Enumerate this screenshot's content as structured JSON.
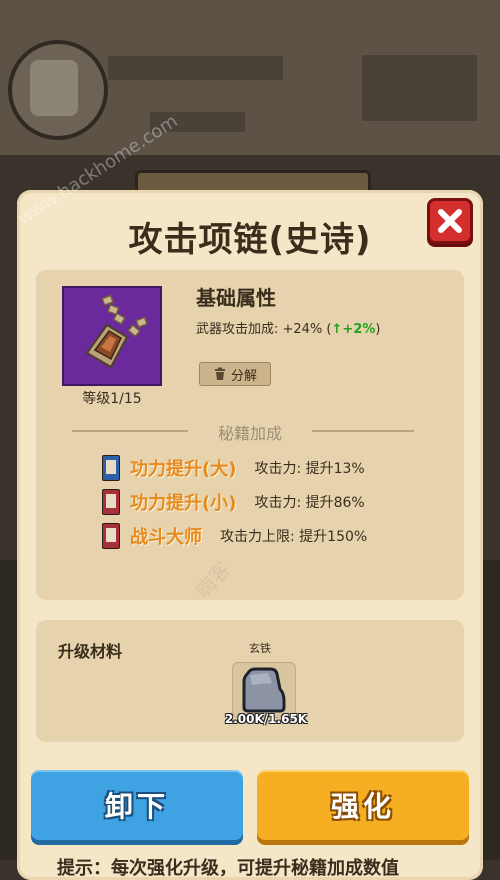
{
  "dialog": {
    "title": "攻击项链(史诗)",
    "close_icon": "close-icon"
  },
  "item": {
    "icon": "necklace-icon",
    "level_text": "等级1/15"
  },
  "basic": {
    "title": "基础属性",
    "stat_text": "武器攻击加成: +24% (",
    "stat_bonus": "+2%",
    "stat_close": ")",
    "decompose_label": "分解"
  },
  "secret": {
    "header": "秘籍加成",
    "books": [
      {
        "name": "功力提升(大)",
        "effect": "攻击力: 提升13%",
        "color": "blue"
      },
      {
        "name": "功力提升(小)",
        "effect": "攻击力: 提升86%",
        "color": "red"
      },
      {
        "name": "战斗大师",
        "effect": "攻击力上限: 提升150%",
        "color": "red"
      }
    ]
  },
  "materials": {
    "title": "升级材料",
    "item_name": "玄铁",
    "count": "2.00K/1.65K"
  },
  "actions": {
    "unequip": "卸下",
    "enhance": "强化"
  },
  "tip": "提示：每次强化升级，可提升秘籍加成数值",
  "watermarks": {
    "primary": "www.hackhome.com",
    "secondary": "嗨客"
  },
  "colors": {
    "bonus_green": "#1fa21f",
    "book_name_orange": "#e58a1b",
    "unequip_blue": "#3fa3e3",
    "enhance_orange": "#f6ae22",
    "close_red": "#d42e2e",
    "item_bg_purple": "#6a2a9c"
  }
}
